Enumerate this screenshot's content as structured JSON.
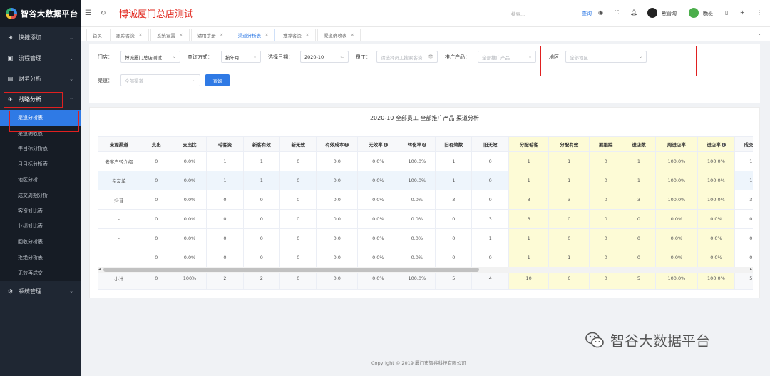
{
  "app": {
    "logo_text": "智谷大数据平台",
    "shop_title": "博诚厦门总店测试"
  },
  "sidebar": {
    "groups": [
      {
        "label": "快捷添加",
        "icon": "plus-circle-icon"
      },
      {
        "label": "流程管理",
        "icon": "briefcase-icon"
      },
      {
        "label": "财务分析",
        "icon": "finance-icon"
      },
      {
        "label": "战略分析",
        "icon": "plane-icon"
      }
    ],
    "strategy_items": [
      "渠道分析表",
      "渠道确收表",
      "年目标分析表",
      "月目标分析表",
      "地区分析",
      "成交周期分析",
      "客资对比表",
      "业绩对比表",
      "回收分析表",
      "拒绝分析表",
      "无效再成交"
    ],
    "system_label": "系统管理"
  },
  "header": {
    "search_placeholder": "搜索...",
    "search_button": "查询",
    "user1": "熊管淘",
    "user2": "晚班"
  },
  "tabs": [
    {
      "label": "首页",
      "closable": false
    },
    {
      "label": "跟踪客资",
      "closable": true
    },
    {
      "label": "系统设置",
      "closable": true
    },
    {
      "label": "请用手册",
      "closable": true
    },
    {
      "label": "渠道分析表",
      "closable": true,
      "active": true
    },
    {
      "label": "推荐客资",
      "closable": true
    },
    {
      "label": "渠道确收表",
      "closable": true
    }
  ],
  "filters": {
    "store_label": "门店：",
    "store_value": "博诚厦门总店测试",
    "mode_label": "查询方式：",
    "mode_value": "按年月",
    "date_label": "选择日期：",
    "date_value": "2020-10",
    "staff_label": "员工：",
    "staff_placeholder": "请选择员工搜索客资",
    "product_label": "推广产品：",
    "product_placeholder": "全部推广产品",
    "region_label": "地区",
    "region_placeholder": "全部地区",
    "channel_label": "渠道：",
    "channel_placeholder": "全部渠道",
    "query_button": "查询"
  },
  "report": {
    "title": "2020-10 全部员工 全部推广产品 渠道分析",
    "headers": [
      "来源渠道",
      "支出",
      "支出比",
      "毛客资",
      "新客有效",
      "新无效",
      "有效成本",
      "无效率",
      "转化率",
      "旧有效数",
      "旧无效",
      "分配毛客",
      "分配有效",
      "要跟踪",
      "进店数",
      "周进店率",
      "进店率",
      "成交数"
    ],
    "rows": [
      [
        "老客户转介绍",
        "0",
        "0.0%",
        "1",
        "1",
        "0",
        "0.0",
        "0.0%",
        "100.0%",
        "1",
        "0",
        "1",
        "1",
        "0",
        "1",
        "100.0%",
        "100.0%",
        "1"
      ],
      [
        "亲友单",
        "0",
        "0.0%",
        "1",
        "1",
        "0",
        "0.0",
        "0.0%",
        "100.0%",
        "1",
        "0",
        "1",
        "1",
        "0",
        "1",
        "100.0%",
        "100.0%",
        "1"
      ],
      [
        "抖音",
        "0",
        "0.0%",
        "0",
        "0",
        "0",
        "0.0",
        "0.0%",
        "0.0%",
        "3",
        "0",
        "3",
        "3",
        "0",
        "3",
        "100.0%",
        "100.0%",
        "3"
      ],
      [
        "-",
        "0",
        "0.0%",
        "0",
        "0",
        "0",
        "0.0",
        "0.0%",
        "0.0%",
        "0",
        "3",
        "3",
        "0",
        "0",
        "0",
        "0.0%",
        "0.0%",
        "0"
      ],
      [
        "-",
        "0",
        "0.0%",
        "0",
        "0",
        "0",
        "0.0",
        "0.0%",
        "0.0%",
        "0",
        "1",
        "1",
        "0",
        "0",
        "0",
        "0.0%",
        "0.0%",
        "0"
      ],
      [
        "-",
        "0",
        "0.0%",
        "0",
        "0",
        "0",
        "0.0",
        "0.0%",
        "0.0%",
        "0",
        "0",
        "1",
        "1",
        "0",
        "0",
        "0.0%",
        "0.0%",
        "0"
      ]
    ],
    "total": [
      "小计",
      "0",
      "100%",
      "2",
      "2",
      "0",
      "0.0",
      "0.0%",
      "100.0%",
      "5",
      "4",
      "10",
      "6",
      "0",
      "5",
      "100.0%",
      "100.0%",
      "5"
    ]
  },
  "footer": {
    "copyright": "Copyright © 2019 厦门市智谷科技有限公司",
    "watermark": "智谷大数据平台"
  }
}
